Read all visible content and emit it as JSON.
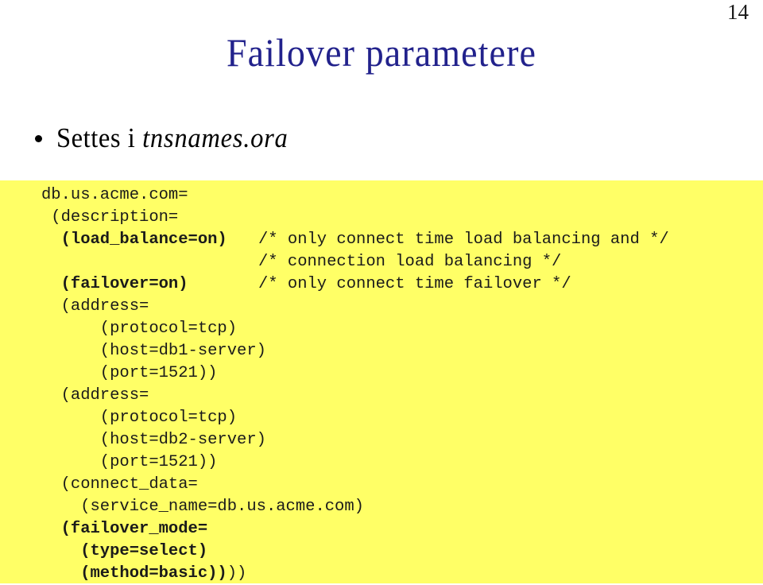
{
  "slide": {
    "page_number": "14",
    "title": "Failover parametere",
    "title_color": "#22228c",
    "background_color": "#ffffff"
  },
  "bullet": {
    "marker": "bullet-dot",
    "text_plain": "Settes i ",
    "text_italic": "tnsnames.ora"
  },
  "code_block": {
    "background_color": "#ffff66",
    "text_color": "#1a1a1a",
    "lines": [
      {
        "indent": "",
        "code": "db.us.acme.com=",
        "bold": false,
        "comment": ""
      },
      {
        "indent": " ",
        "code": "(description=",
        "bold": false,
        "comment": ""
      },
      {
        "indent": "  ",
        "code": "(load_balance=on)",
        "bold": true,
        "comment": "/* only connect time load balancing and */"
      },
      {
        "indent": "",
        "code": "",
        "bold": false,
        "comment": "/* connection load balancing */"
      },
      {
        "indent": "  ",
        "code": "(failover=on)",
        "bold": true,
        "comment": "/* only connect time failover */"
      },
      {
        "indent": "  ",
        "code": "(address=",
        "bold": false,
        "comment": ""
      },
      {
        "indent": "      ",
        "code": "(protocol=tcp)",
        "bold": false,
        "comment": ""
      },
      {
        "indent": "      ",
        "code": "(host=db1-server)",
        "bold": false,
        "comment": ""
      },
      {
        "indent": "      ",
        "code": "(port=1521))",
        "bold": false,
        "comment": ""
      },
      {
        "indent": "  ",
        "code": "(address=",
        "bold": false,
        "comment": ""
      },
      {
        "indent": "      ",
        "code": "(protocol=tcp)",
        "bold": false,
        "comment": ""
      },
      {
        "indent": "      ",
        "code": "(host=db2-server)",
        "bold": false,
        "comment": ""
      },
      {
        "indent": "      ",
        "code": "(port=1521))",
        "bold": false,
        "comment": ""
      },
      {
        "indent": "  ",
        "code": "(connect_data=",
        "bold": false,
        "comment": ""
      },
      {
        "indent": "    ",
        "code": "(service_name=db.us.acme.com)",
        "bold": false,
        "comment": ""
      },
      {
        "indent": "  ",
        "code": "(failover_mode=",
        "bold": true,
        "comment": ""
      },
      {
        "indent": "    ",
        "code": "(type=select)",
        "bold": true,
        "comment": ""
      },
      {
        "indent": "    ",
        "code": "(method=basic))",
        "bold": true,
        "trail": "))",
        "comment": ""
      }
    ]
  }
}
